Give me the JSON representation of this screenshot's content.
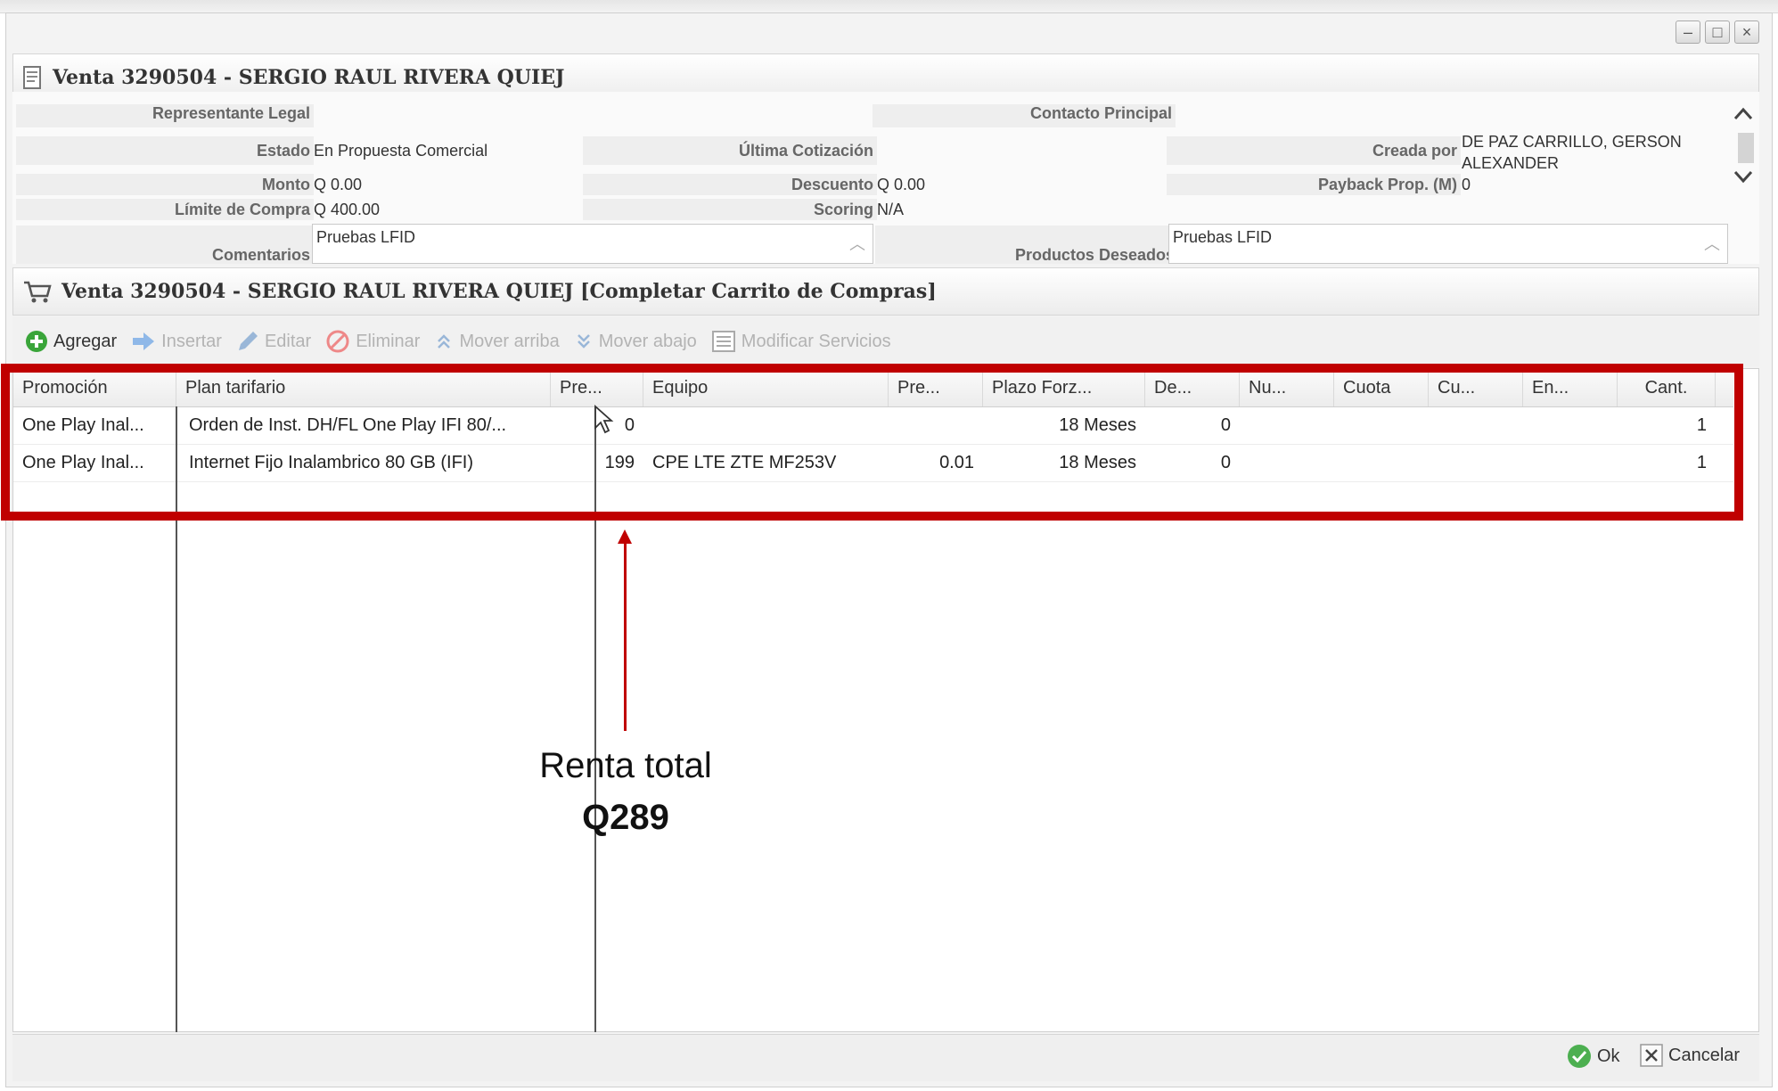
{
  "window": {
    "controls": {
      "minimize": "–",
      "maximize": "□",
      "close": "×"
    }
  },
  "sale_panel": {
    "title": "Venta 3290504 - SERGIO RAUL RIVERA QUIEJ",
    "fields": {
      "representante_legal": {
        "label": "Representante Legal",
        "value": ""
      },
      "contacto_principal": {
        "label": "Contacto Principal",
        "value": ""
      },
      "estado": {
        "label": "Estado",
        "value": "En Propuesta Comercial"
      },
      "ultima_cotizacion": {
        "label": "Última Cotización",
        "value": ""
      },
      "creada_por": {
        "label": "Creada por",
        "value": "DE PAZ CARRILLO, GERSON ALEXANDER"
      },
      "monto": {
        "label": "Monto",
        "value": "Q 0.00"
      },
      "descuento": {
        "label": "Descuento",
        "value": "Q 0.00"
      },
      "payback": {
        "label": "Payback Prop. (M)",
        "value": "0"
      },
      "limite_compra": {
        "label": "Límite de Compra",
        "value": "Q 400.00"
      },
      "scoring": {
        "label": "Scoring",
        "value": "N/A"
      },
      "comentarios": {
        "label": "Comentarios",
        "value": "Pruebas LFID"
      },
      "productos_deseados": {
        "label": "Productos Deseados",
        "value": "Pruebas LFID"
      }
    }
  },
  "cart_panel": {
    "title": "Venta 3290504 - SERGIO RAUL RIVERA QUIEJ [Completar Carrito de Compras]"
  },
  "toolbar": {
    "agregar": "Agregar",
    "insertar": "Insertar",
    "editar": "Editar",
    "eliminar": "Eliminar",
    "mover_arriba": "Mover arriba",
    "mover_abajo": "Mover abajo",
    "modificar_servicios": "Modificar Servicios"
  },
  "grid": {
    "columns": [
      "Promoción",
      "Plan tarifario",
      "Pre...",
      "Equipo",
      "Pre...",
      "Plazo Forz...",
      "De...",
      "Nu...",
      "Cuota",
      "Cu...",
      "En...",
      "Cant."
    ],
    "rows": [
      [
        "One Play Inal...",
        "Orden de Inst. DH/FL One Play IFI 80/...",
        "0",
        "",
        "",
        "18 Meses",
        "0",
        "",
        "",
        "",
        "",
        "1"
      ],
      [
        "One Play Inal...",
        "Internet Fijo Inalambrico 80 GB (IFI)",
        "199",
        "CPE LTE ZTE MF253V",
        "0.01",
        "18 Meses",
        "0",
        "",
        "",
        "",
        "",
        "1"
      ]
    ]
  },
  "footer": {
    "ok": "Ok",
    "cancelar": "Cancelar"
  },
  "annotation": {
    "line1": "Renta total",
    "line2": "Q289"
  },
  "colors": {
    "highlight": "#c00000",
    "ok_green": "#4caf50",
    "agregar_green": "#3aa53a",
    "insert_blue": "#4a90d9",
    "eliminar_red": "#e05050"
  }
}
